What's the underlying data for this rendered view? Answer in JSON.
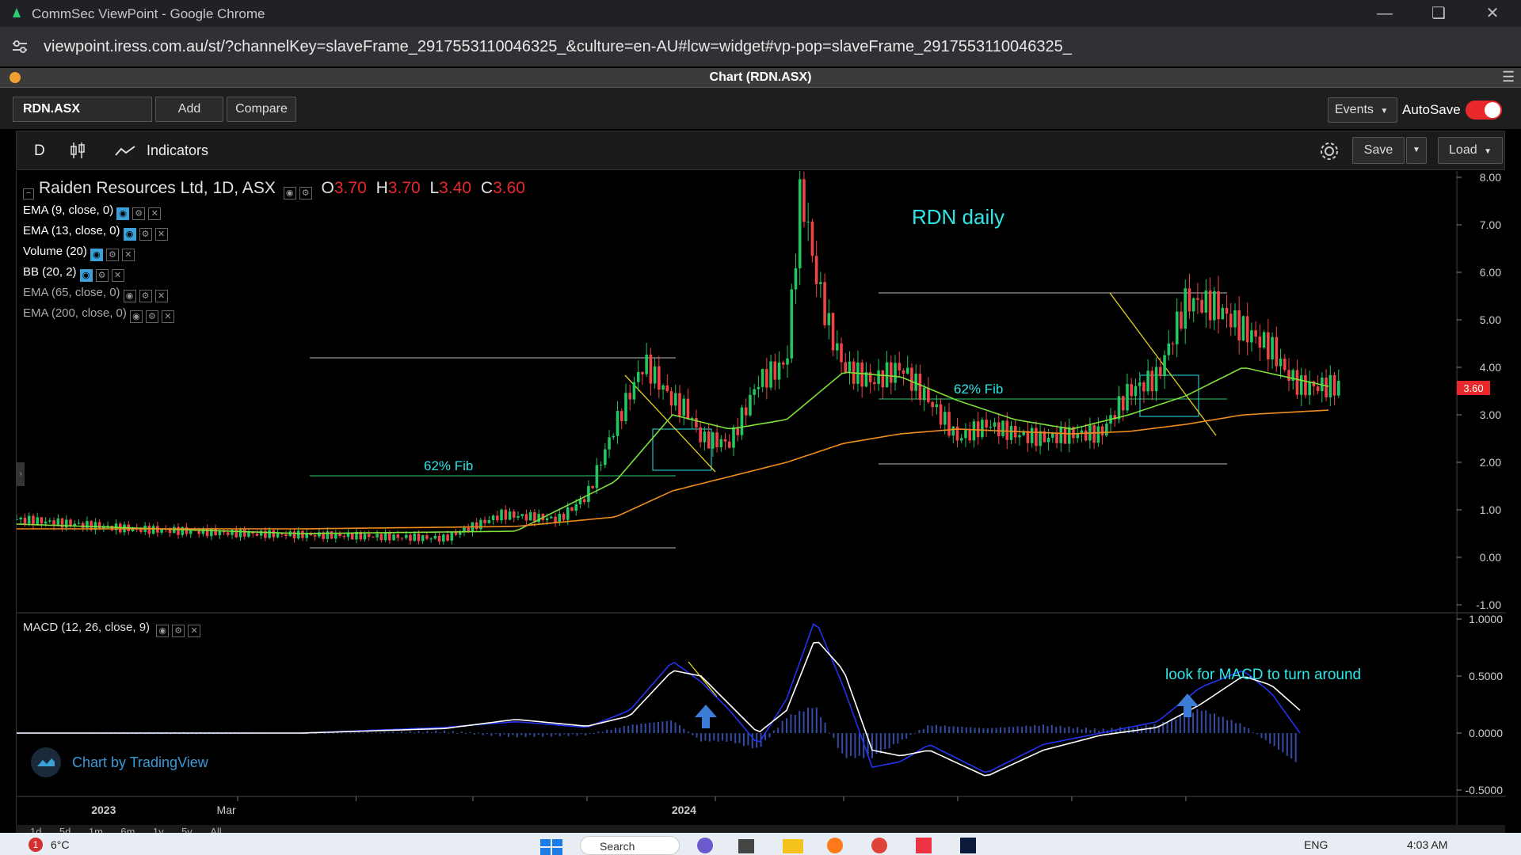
{
  "browser": {
    "window_title": "CommSec ViewPoint - Google Chrome",
    "url": "viewpoint.iress.com.au/st/?channelKey=slaveFrame_2917553110046325_&culture=en-AU#lcw=widget#vp-pop=slaveFrame_2917553110046325_"
  },
  "widget": {
    "title": "Chart (RDN.ASX)"
  },
  "toolbar": {
    "symbol": "RDN.ASX",
    "add_label": "Add",
    "compare_label": "Compare",
    "events_label": "Events",
    "autosave_label": "AutoSave",
    "autosave_on": true,
    "interval_label": "D",
    "indicators_label": "Indicators",
    "save_label": "Save",
    "load_label": "Load"
  },
  "legend": {
    "instrument": "Raiden Resources Ltd, 1D, ASX",
    "o_label": "O",
    "o_value": "3.70",
    "h_label": "H",
    "h_value": "3.70",
    "l_label": "L",
    "l_value": "3.40",
    "c_label": "C",
    "c_value": "3.60",
    "indicators": [
      {
        "label": "EMA (9, close, 0)",
        "visible": true
      },
      {
        "label": "EMA (13, close, 0)",
        "visible": true
      },
      {
        "label": "Volume (20)",
        "visible": true
      },
      {
        "label": "BB (20, 2)",
        "visible": true
      },
      {
        "label": "EMA (65, close, 0)",
        "visible": false
      },
      {
        "label": "EMA (200, close, 0)",
        "visible": false
      }
    ],
    "macd_label": "MACD (12, 26, close, 9)"
  },
  "annotations": {
    "title": "RDN daily",
    "fib_left": "62% Fib",
    "fib_right": "62% Fib",
    "macd_note": "look for MACD to turn around",
    "watermark": "Chart by TradingView"
  },
  "price_axis": {
    "ticks": [
      "8.00",
      "7.00",
      "6.00",
      "5.00",
      "4.00",
      "3.00",
      "2.00",
      "1.00",
      "0.00",
      "-1.00"
    ],
    "last_price": "3.60",
    "last_price_color": "#e8282b"
  },
  "macd_axis": {
    "ticks": [
      "1.0000",
      "0.5000",
      "0.0000",
      "-0.5000"
    ]
  },
  "time_axis": {
    "labels": [
      "2023",
      "Mar",
      "2024"
    ]
  },
  "timeframes": [
    "1d",
    "5d",
    "1m",
    "6m",
    "1y",
    "5y",
    "All"
  ],
  "taskbar": {
    "weather": "6°C",
    "notification_count": "1",
    "search_label": "Search",
    "lang": "ENG",
    "time": "4:03 AM"
  },
  "colors": {
    "up_candle": "#22c55e",
    "down_candle": "#ef4444",
    "ema_fast": "#7ee03a",
    "ema_slow": "#f08c1e",
    "macd_line": "#2233ee",
    "signal_line": "#ffffff",
    "annotation_cyan": "#2ee6e6",
    "trend_yellow": "#e6d21e"
  },
  "chart_data": {
    "type": "line",
    "title": "RDN daily",
    "price_ylim": [
      -1,
      8
    ],
    "macd_ylim": [
      -0.5,
      1.0
    ],
    "price_series": {
      "name": "Price",
      "x": [
        0,
        0.08,
        0.16,
        0.24,
        0.3,
        0.34,
        0.38,
        0.4,
        0.42,
        0.44,
        0.46,
        0.47,
        0.48,
        0.5,
        0.52,
        0.54,
        0.55,
        0.56,
        0.57,
        0.58,
        0.6,
        0.62,
        0.64,
        0.66,
        0.68,
        0.7,
        0.72,
        0.74,
        0.76,
        0.78,
        0.8,
        0.82,
        0.84,
        0.86,
        0.88,
        0.89,
        0.9,
        0.91,
        0.92,
        0.93
      ],
      "values": [
        0.8,
        0.6,
        0.5,
        0.45,
        0.4,
        0.9,
        0.8,
        1.3,
        2.8,
        4.1,
        3.3,
        3.1,
        2.5,
        2.4,
        3.7,
        4.1,
        7.8,
        6.0,
        4.8,
        4.0,
        3.7,
        4.0,
        3.3,
        2.5,
        2.8,
        2.6,
        2.5,
        2.6,
        2.6,
        3.5,
        3.8,
        5.4,
        5.3,
        4.8,
        4.4,
        3.9,
        3.6,
        3.6,
        3.6,
        3.6
      ]
    },
    "ema_fast": {
      "name": "EMA (9, close, 0)",
      "x": [
        0,
        0.2,
        0.35,
        0.42,
        0.46,
        0.5,
        0.54,
        0.58,
        0.62,
        0.66,
        0.7,
        0.74,
        0.78,
        0.82,
        0.86,
        0.92
      ],
      "values": [
        0.7,
        0.5,
        0.55,
        1.6,
        3.0,
        2.7,
        2.9,
        3.9,
        3.8,
        3.3,
        2.9,
        2.7,
        3.0,
        3.4,
        4.0,
        3.6
      ]
    },
    "ema_slow": {
      "name": "EMA (13, close, 0)",
      "x": [
        0,
        0.2,
        0.35,
        0.42,
        0.46,
        0.5,
        0.54,
        0.58,
        0.62,
        0.66,
        0.7,
        0.74,
        0.78,
        0.82,
        0.86,
        0.92
      ],
      "values": [
        0.6,
        0.6,
        0.65,
        0.85,
        1.4,
        1.7,
        2.0,
        2.4,
        2.6,
        2.7,
        2.65,
        2.6,
        2.65,
        2.8,
        3.0,
        3.1
      ]
    },
    "macd_line": {
      "name": "MACD",
      "x": [
        0,
        0.2,
        0.3,
        0.35,
        0.4,
        0.43,
        0.46,
        0.48,
        0.5,
        0.52,
        0.54,
        0.56,
        0.58,
        0.6,
        0.62,
        0.64,
        0.68,
        0.72,
        0.76,
        0.8,
        0.83,
        0.86,
        0.88,
        0.9
      ],
      "values": [
        0,
        0,
        0.05,
        0.1,
        0.05,
        0.2,
        0.63,
        0.45,
        0.2,
        -0.1,
        0.3,
        1.0,
        0.4,
        -0.3,
        -0.25,
        -0.1,
        -0.35,
        -0.1,
        0.0,
        0.1,
        0.4,
        0.55,
        0.35,
        0.0
      ]
    },
    "signal_line": {
      "name": "Signal",
      "x": [
        0,
        0.2,
        0.3,
        0.35,
        0.4,
        0.43,
        0.46,
        0.48,
        0.5,
        0.52,
        0.54,
        0.56,
        0.58,
        0.6,
        0.62,
        0.64,
        0.68,
        0.72,
        0.76,
        0.8,
        0.83,
        0.86,
        0.88,
        0.9
      ],
      "values": [
        0,
        0,
        0.04,
        0.12,
        0.06,
        0.15,
        0.55,
        0.5,
        0.25,
        0.0,
        0.2,
        0.83,
        0.55,
        -0.15,
        -0.2,
        -0.15,
        -0.38,
        -0.15,
        -0.02,
        0.05,
        0.25,
        0.5,
        0.42,
        0.2
      ]
    }
  }
}
